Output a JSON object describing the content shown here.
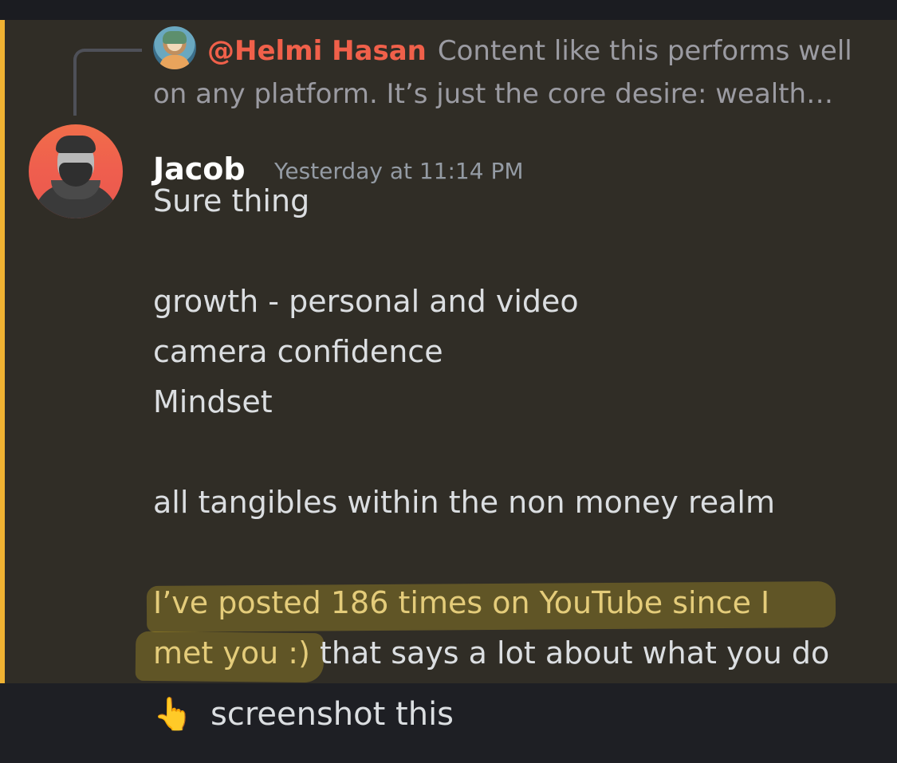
{
  "reply": {
    "author": "@Helmi Hasan",
    "preview_line1": "Content like this performs well",
    "preview_line2": "on any platform. It’s just the core desire: wealth…"
  },
  "message": {
    "author": "Jacob",
    "timestamp": "Yesterday at 11:14 PM",
    "lines": {
      "l1": "Sure thing",
      "l2": "growth - personal and video",
      "l3": "camera confidence",
      "l4": "Mindset",
      "l5": "all tangibles within the non money realm",
      "l6_highlight": "I’ve posted 186 times on YouTube since I",
      "l7_highlight": "met you :)",
      "l7_rest": " that says a lot about what you do"
    }
  },
  "caption": {
    "emoji": "👆",
    "text": "screenshot this"
  },
  "colors": {
    "mention_bar": "#f0b232",
    "message_bg": "#302d26",
    "author_red": "#f0604a",
    "highlight": "#cfb228"
  },
  "icons": {
    "reply_avatar": "helmi-avatar",
    "author_avatar": "jacob-avatar"
  }
}
